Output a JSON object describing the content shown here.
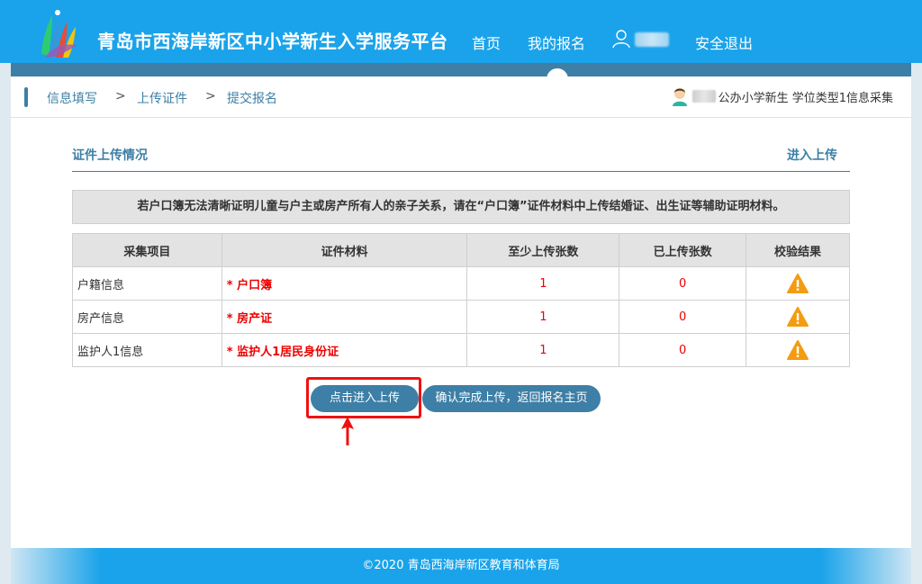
{
  "header": {
    "title": "青岛市西海岸新区中小学新生入学服务平台",
    "nav": {
      "home": "首页",
      "my_registration": "我的报名",
      "logout": "安全退出"
    }
  },
  "breadcrumb": {
    "step1": "信息填写",
    "sep": ">",
    "step2": "上传证件",
    "step3": "提交报名"
  },
  "student_info": "公办小学新生 学位类型1信息采集",
  "section": {
    "title": "证件上传情况",
    "action": "进入上传"
  },
  "notice": "若户口簿无法清晰证明儿童与户主或房产所有人的亲子关系，请在“户口簿”证件材料中上传结婚证、出生证等辅助证明材料。",
  "table": {
    "headers": [
      "采集项目",
      "证件材料",
      "至少上传张数",
      "已上传张数",
      "校验结果"
    ],
    "rows": [
      {
        "item": "户籍信息",
        "material": "* 户口簿",
        "min": "1",
        "uploaded": "0",
        "result_icon": "warning-icon"
      },
      {
        "item": "房产信息",
        "material": "* 房产证",
        "min": "1",
        "uploaded": "0",
        "result_icon": "warning-icon"
      },
      {
        "item": "监护人1信息",
        "material": "* 监护人1居民身份证",
        "min": "1",
        "uploaded": "0",
        "result_icon": "warning-icon"
      }
    ]
  },
  "buttons": {
    "upload": "点击进入上传",
    "confirm": "确认完成上传，返回报名主页"
  },
  "footer": "©2020 青岛西海岸新区教育和体育局",
  "colors": {
    "primary": "#1aa3ea",
    "accent": "#3d7fa6",
    "required": "#e00000",
    "warning": "#f39c12",
    "highlight": "#e11111"
  }
}
